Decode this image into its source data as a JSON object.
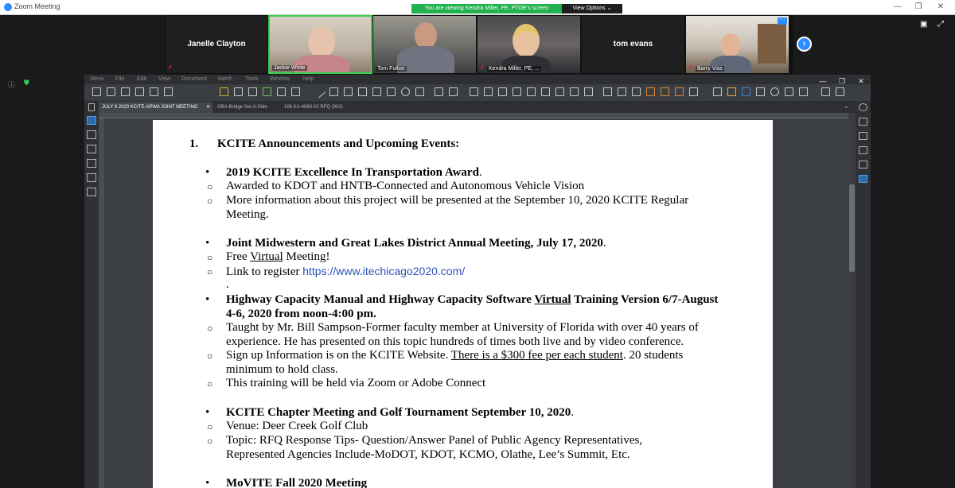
{
  "zoom": {
    "window_title": "Zoom Meeting",
    "viewing_banner": "You are viewing Kendra Miller, PE, PTOE's screen",
    "view_options": "View Options ⌄",
    "participants": [
      {
        "name": "Janelle Clayton",
        "video": false,
        "muted": true
      },
      {
        "name": "Jackie White",
        "video": true,
        "muted": false,
        "active": true
      },
      {
        "name": "Tom Fulton",
        "video": true,
        "muted": false
      },
      {
        "name": "Kendra Miller, PE, ...",
        "video": true,
        "muted": true
      },
      {
        "name": "tom evans",
        "video": false,
        "muted": false
      },
      {
        "name": "Barry Viss",
        "video": true,
        "muted": true
      }
    ]
  },
  "revu": {
    "menu": [
      "Revu",
      "File",
      "Edit",
      "View",
      "Document",
      "Batch",
      "Tools",
      "Window",
      "Help"
    ],
    "tabs": [
      {
        "label": "JULY 9 2020 KCITE-APWA JOINT MEETING",
        "active": true
      },
      {
        "label": "GBA-Bridge Set-A-Side",
        "active": false
      },
      {
        "label": "106 KA-4960-02 RFQ (002)",
        "active": false
      }
    ]
  },
  "document": {
    "heading_number": "1.",
    "heading": "KCITE Announcements and Upcoming Events:",
    "sections": [
      {
        "title": "2019 KCITE Excellence In Transportation Award",
        "title_tail": ".",
        "items": [
          "Awarded to KDOT and HNTB-Connected and Autonomous Vehicle Vision",
          "More information about this project will be presented at the September 10, 2020 KCITE Regular",
          "Meeting."
        ]
      },
      {
        "title": "Joint Midwestern and Great Lakes District Annual Meeting, July 17, 2020",
        "title_tail": ".",
        "free_pre": "Free ",
        "free_u": "Virtual",
        "free_post": " Meeting!",
        "link_pre": "Link to register ",
        "link": "https://www.itechicago2020.com/",
        "dot": "."
      },
      {
        "title_a": "Highway Capacity Manual and Highway Capacity Software ",
        "title_u": "Virtual",
        "title_b": " Training Version 6/7-August",
        "title_c": "4-6, 2020 from noon-4:00 pm.",
        "items": [
          "Taught by Mr. Bill Sampson-Former faculty member at University of Florida with over 40 years of",
          "experience.  He has presented on this topic hundreds of times both live and by video conference."
        ],
        "signup_pre": "Sign up Information is on the KCITE Website. ",
        "signup_u": "There is a $300 fee per each student",
        "signup_post": ".  20 students",
        "signup_cont": "minimum to hold class.",
        "zoom_item": "This training will be held via Zoom or Adobe Connect"
      },
      {
        "title": "KCITE Chapter Meeting and Golf Tournament September 10, 2020",
        "title_tail": ".",
        "items": [
          "Venue: Deer Creek Golf Club",
          "Topic: RFQ Response Tips- Question/Answer Panel of Public Agency Representatives,",
          "Represented Agencies Include-MoDOT, KDOT, KCMO, Olathe, Lee’s Summit, Etc."
        ]
      },
      {
        "title": "MoVITE Fall 2020 Meeting"
      }
    ]
  }
}
